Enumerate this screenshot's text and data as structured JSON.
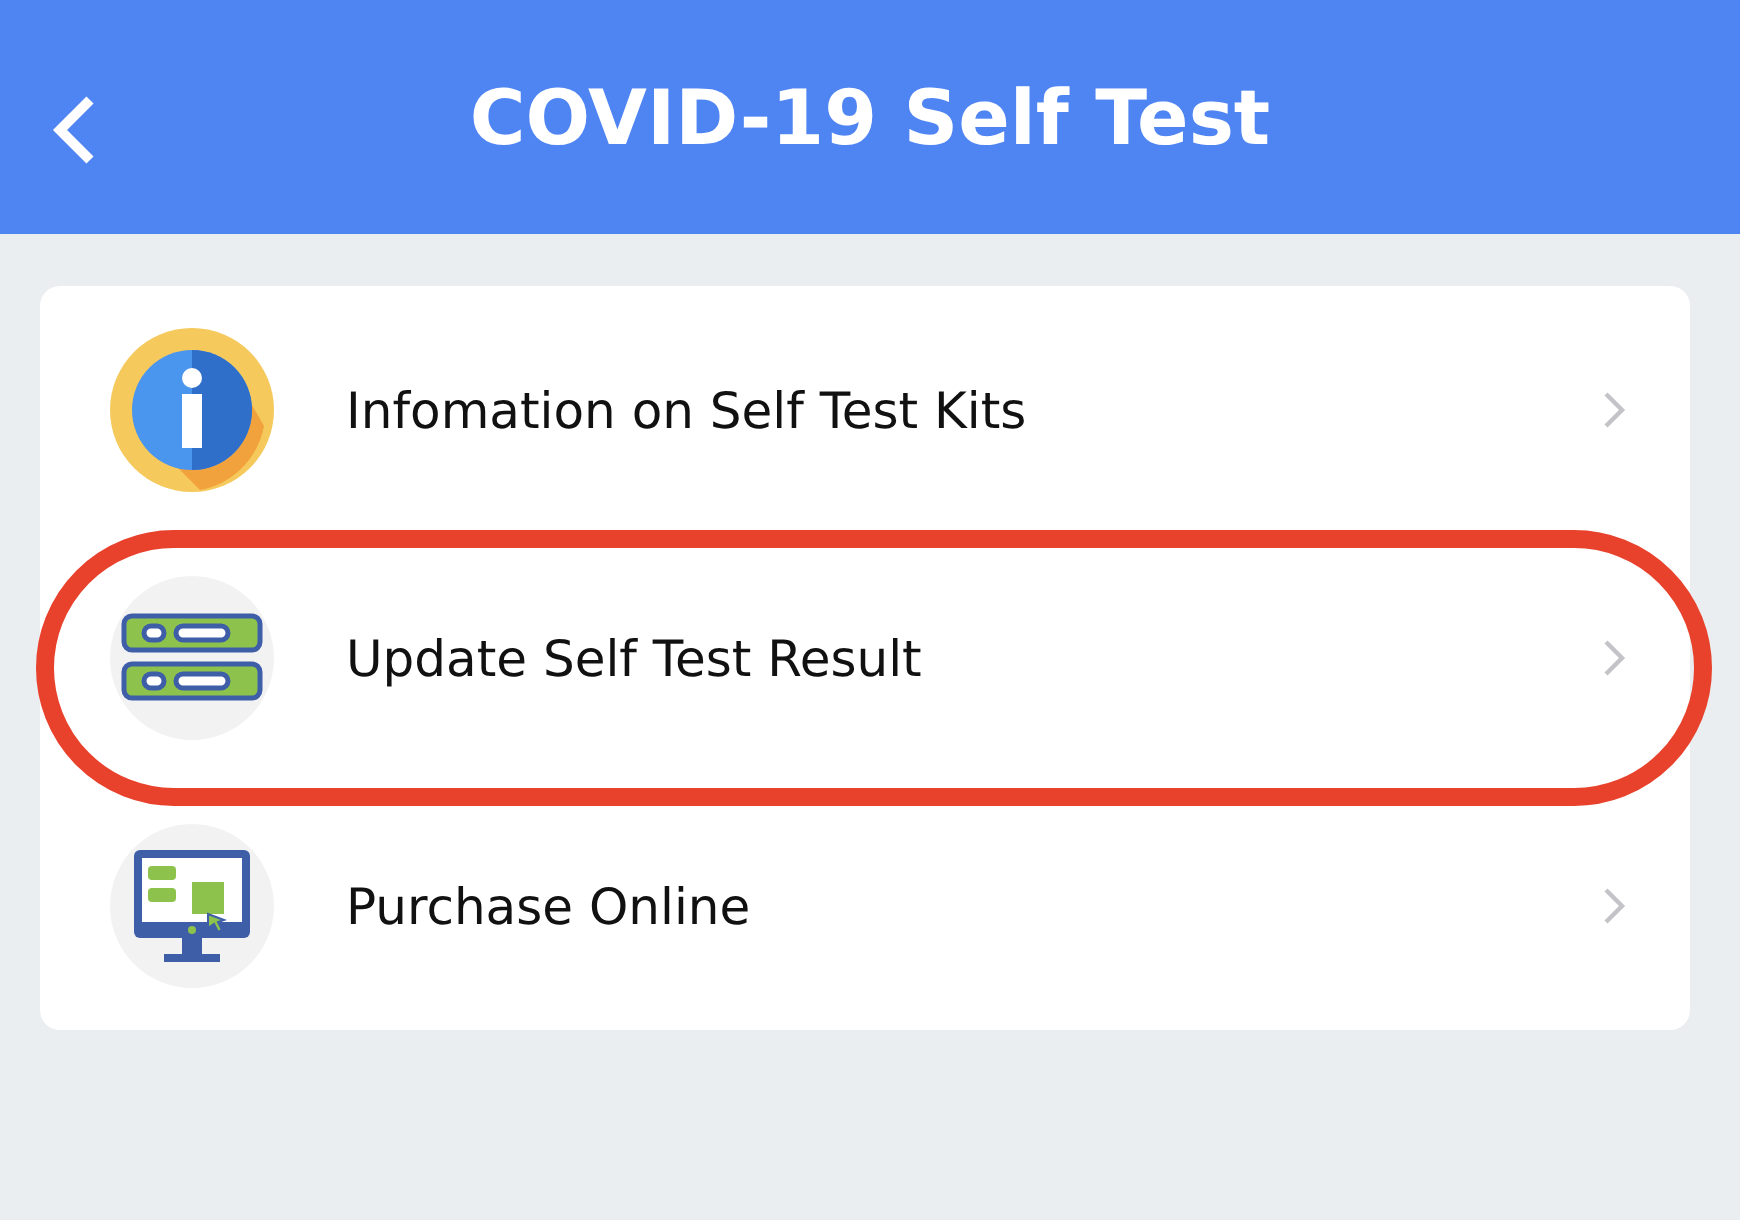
{
  "header": {
    "title": "COVID-19 Self Test"
  },
  "menu": [
    {
      "kind": "info",
      "label": "Infomation on Self Test Kits",
      "highlighted": false
    },
    {
      "kind": "result",
      "label": "Update Self Test Result",
      "highlighted": true
    },
    {
      "kind": "purchase",
      "label": "Purchase Online",
      "highlighted": false
    }
  ]
}
